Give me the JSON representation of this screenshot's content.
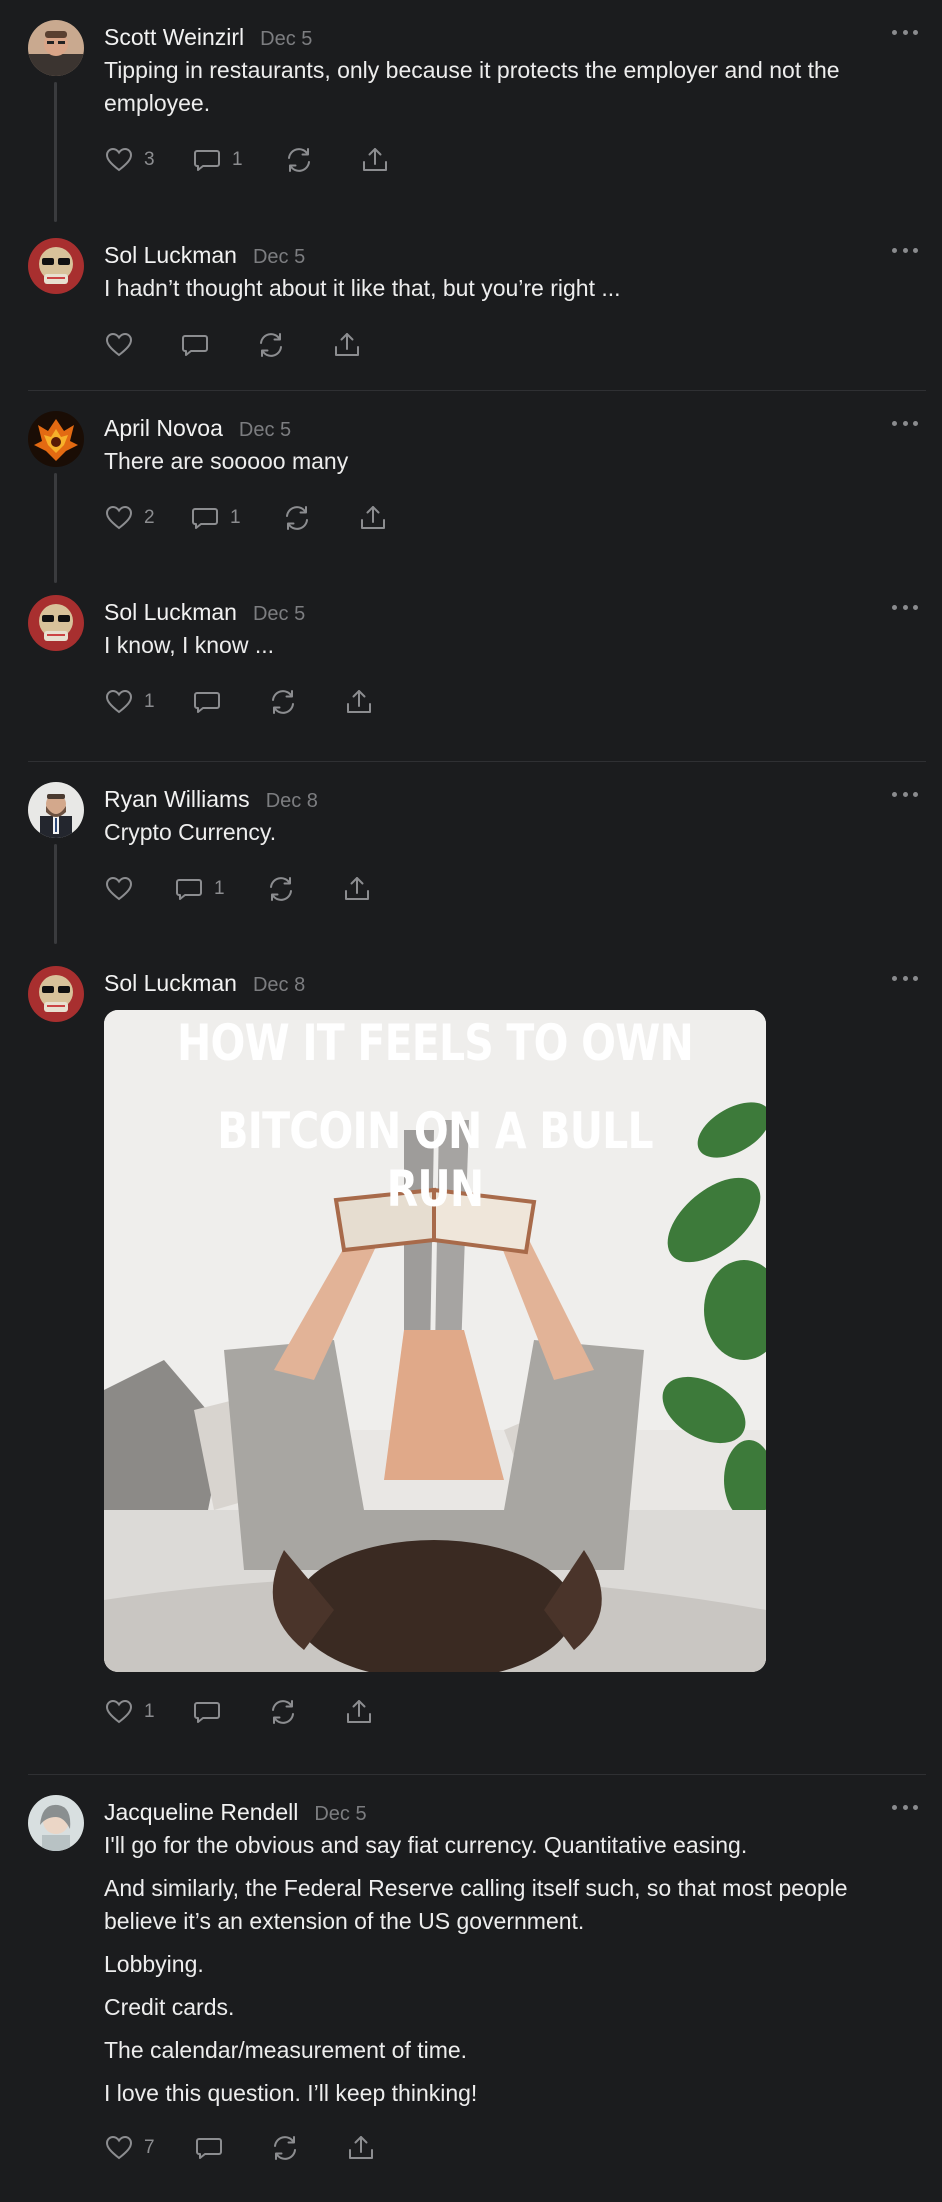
{
  "comments": [
    {
      "author": "Scott Weinzirl",
      "date": "Dec 5",
      "paragraphs": [
        "Tipping in restaurants, only because it protects the employer and not the employee."
      ],
      "likes": "3",
      "replies": "1"
    },
    {
      "author": "Sol Luckman",
      "date": "Dec 5",
      "paragraphs": [
        "I hadn’t thought about it like that, but you’re right ..."
      ],
      "likes": "",
      "replies": ""
    },
    {
      "author": "April Novoa",
      "date": "Dec 5",
      "paragraphs": [
        "There are sooooo many"
      ],
      "likes": "2",
      "replies": "1"
    },
    {
      "author": "Sol Luckman",
      "date": "Dec 5",
      "paragraphs": [
        "I know, I know ..."
      ],
      "likes": "1",
      "replies": ""
    },
    {
      "author": "Ryan Williams",
      "date": "Dec 8",
      "paragraphs": [
        "Crypto Currency."
      ],
      "likes": "",
      "replies": "1"
    },
    {
      "author": "Sol Luckman",
      "date": "Dec 8",
      "image_caption_line1": "HOW IT FEELS TO OWN",
      "image_caption_line2": "BITCOIN ON A BULL RUN",
      "likes": "1",
      "replies": ""
    },
    {
      "author": "Jacqueline Rendell",
      "date": "Dec 5",
      "paragraphs": [
        "I'll go for the obvious and say fiat currency. Quantitative easing.",
        "And similarly, the Federal Reserve calling itself such, so that most people believe it’s an extension of the US government.",
        "Lobbying.",
        "Credit cards.",
        "The calendar/measurement of time.",
        "I love this question. I’ll keep thinking!"
      ],
      "likes": "7",
      "replies": ""
    }
  ],
  "colors": {
    "background": "#1b1c1e",
    "text": "#ededed",
    "muted": "#7c7d80",
    "icon": "#8c8d90",
    "divider": "#2f3033"
  },
  "icons": [
    "heart-icon",
    "comment-icon",
    "restack-icon",
    "share-icon",
    "more-icon"
  ]
}
